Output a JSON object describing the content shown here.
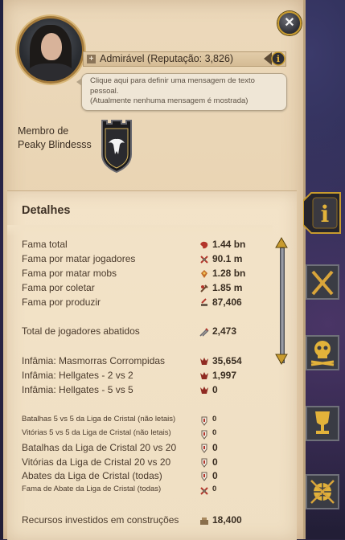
{
  "profile": {
    "reputation_label": "Admirável (Reputação: 3,826)",
    "tooltip_line1": "Clique aqui para definir uma mensagem de texto",
    "tooltip_line2": "pessoal.",
    "tooltip_line3": "(Atualmente nenhuma mensagem é mostrada)",
    "guild_line1": "Membro de",
    "guild_line2": "Peaky Blindesss",
    "close_symbol": "✕"
  },
  "details": {
    "title": "Detalhes",
    "rows": [
      {
        "label": "Fama total",
        "value": "1.44 bn",
        "icon": "fame-total-icon"
      },
      {
        "label": "Fama por matar jogadores",
        "value": "90.1 m",
        "icon": "fame-pvp-icon"
      },
      {
        "label": "Fama por matar mobs",
        "value": "1.28 bn",
        "icon": "fame-pve-icon"
      },
      {
        "label": "Fama por coletar",
        "value": "1.85 m",
        "icon": "fame-gathering-icon"
      },
      {
        "label": "Fama por produzir",
        "value": "87,406",
        "icon": "fame-crafting-icon"
      },
      {
        "label": "Total de jogadores abatidos",
        "value": "2,473",
        "icon": "kills-icon"
      },
      {
        "label": "Infâmia: Masmorras Corrompidas",
        "value": "35,654",
        "icon": "infamy-icon"
      },
      {
        "label": "Infâmia: Hellgates - 2 vs 2",
        "value": "1,997",
        "icon": "infamy-icon"
      },
      {
        "label": "Infâmia: Hellgates - 5 vs 5",
        "value": "0",
        "icon": "infamy-icon"
      },
      {
        "label": "Batalhas 5 vs 5 da Liga de Cristal (não letais)",
        "value": "0",
        "icon": "crystal-icon"
      },
      {
        "label": "Vitórias 5 vs 5 da Liga de Cristal (não letais)",
        "value": "0",
        "icon": "crystal-icon"
      },
      {
        "label": "Batalhas da Liga de Cristal 20 vs 20",
        "value": "0",
        "icon": "crystal-icon"
      },
      {
        "label": "Vitórias da Liga de Cristal 20 vs 20",
        "value": "0",
        "icon": "crystal-icon"
      },
      {
        "label": "Abates da Liga de Cristal (todas)",
        "value": "0",
        "icon": "crystal-icon"
      },
      {
        "label": "Fama de Abate da Liga de Cristal (todas)",
        "value": "0",
        "icon": "crystal-fame-icon"
      },
      {
        "label": "Recursos investidos em construções",
        "value": "18,400",
        "icon": "resources-icon"
      }
    ]
  },
  "side_tabs": [
    {
      "name": "info",
      "symbol": "i"
    },
    {
      "name": "pvp"
    },
    {
      "name": "pve"
    },
    {
      "name": "crystal-league"
    },
    {
      "name": "guild"
    }
  ],
  "colors": {
    "panel": "#ecd9bb",
    "gold_frame": "#c89b2e",
    "fame_red": "#b3352b"
  }
}
